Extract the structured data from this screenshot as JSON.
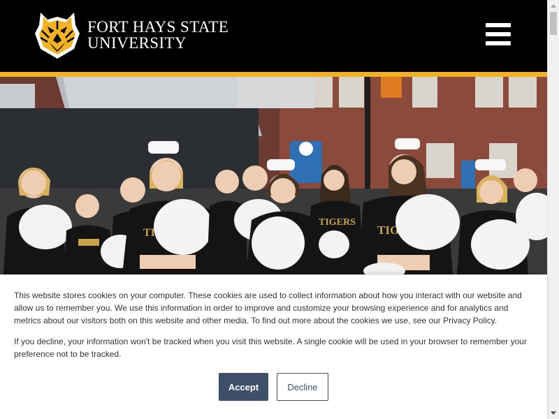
{
  "header": {
    "logo_line1": "FORT HAYS STATE",
    "logo_line2": "UNIVERSITY",
    "menu_icon": "hamburger-menu-icon"
  },
  "hero": {
    "image_subject": "cheerleaders-parade-photo",
    "uniform_text": "TIGERS"
  },
  "cookie_banner": {
    "paragraph1": "This website stores cookies on your computer. These cookies are used to collect information about how you interact with our website and allow us to remember you. We use this information in order to improve and customize your browsing experience and for analytics and metrics about our visitors both on this website and other media. To find out more about the cookies we use, see our Privacy Policy.",
    "paragraph2": "If you decline, your information won't be tracked when you visit this website. A single cookie will be used in your browser to remember your preference not to be tracked.",
    "accept_label": "Accept",
    "decline_label": "Decline"
  },
  "colors": {
    "header_bg": "#000000",
    "accent_gold": "#f3b222",
    "button_primary": "#3d5068"
  }
}
